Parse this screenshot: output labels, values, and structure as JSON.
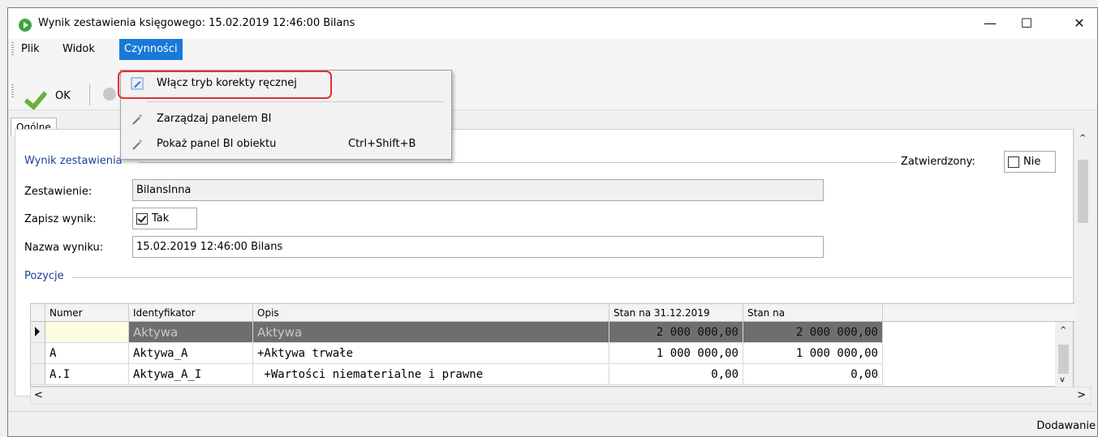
{
  "window": {
    "title": "Wynik zestawienia księgowego: 15.02.2019 12:46:00 Bilans",
    "minimize": "—",
    "maximize": "☐",
    "close": "✕"
  },
  "menu": {
    "items": [
      {
        "label": "Plik"
      },
      {
        "label": "Widok"
      },
      {
        "label": "Czynności"
      }
    ]
  },
  "toolbar": {
    "ok_label": "OK"
  },
  "dropdown": {
    "items": [
      {
        "label": "Włącz tryb korekty ręcznej",
        "shortcut": ""
      },
      {
        "label": "Zarządzaj panelem BI",
        "shortcut": ""
      },
      {
        "label": "Pokaż panel BI obiektu",
        "shortcut": "Ctrl+Shift+B"
      }
    ]
  },
  "tabs": [
    {
      "label": "Ogólne"
    }
  ],
  "result_section": {
    "title": "Wynik zestawienia",
    "approved_label": "Zatwierdzony:",
    "approved_value": "Nie",
    "statement_label": "Zestawienie:",
    "statement_value": "BilansInna",
    "save_label": "Zapisz wynik:",
    "save_value": "Tak",
    "name_label": "Nazwa wyniku:",
    "name_value": "15.02.2019 12:46:00 Bilans"
  },
  "positions": {
    "title": "Pozycje",
    "columns": [
      "Numer",
      "Identyfikator",
      "Opis",
      "Stan na 31.12.2019",
      "Stan na"
    ],
    "rows": [
      [
        "",
        "Aktywa",
        "Aktywa",
        "2 000 000,00",
        "2 000 000,00"
      ],
      [
        "A",
        "Aktywa_A",
        "+Aktywa trwałe",
        "1 000 000,00",
        "1 000 000,00"
      ],
      [
        "A.I",
        "Aktywa_A_I",
        " +Wartości niematerialne i prawne",
        "0,00",
        "0,00"
      ]
    ]
  },
  "status": {
    "text": "Dodawanie"
  }
}
